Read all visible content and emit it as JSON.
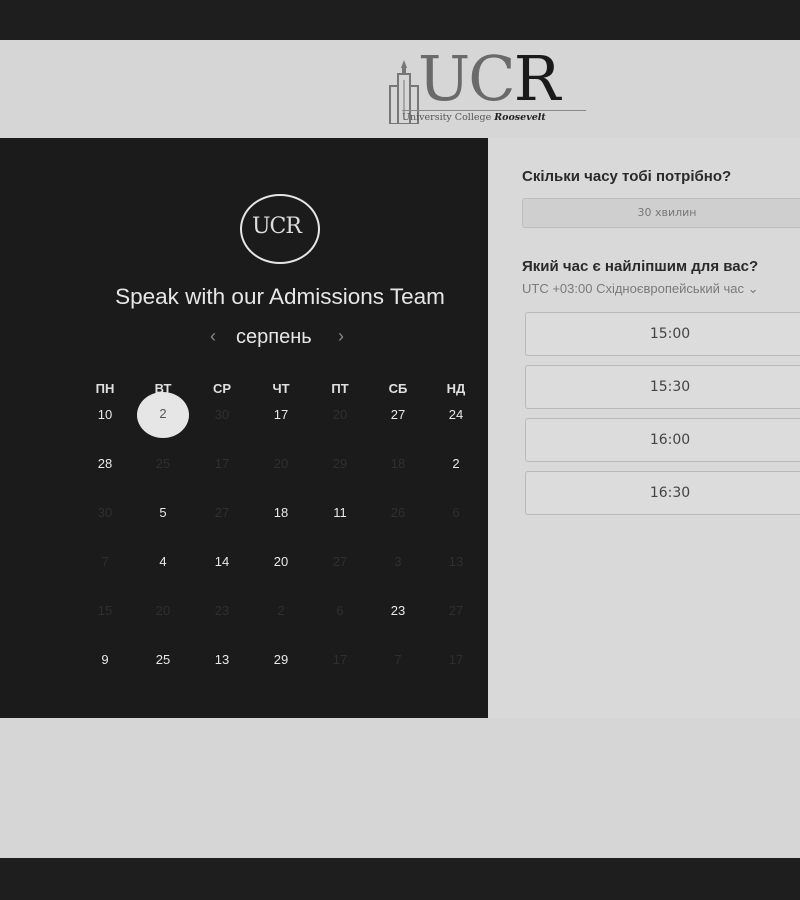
{
  "brand": {
    "logo_text_u": "U",
    "logo_text_c": "C",
    "logo_text_r": "R",
    "logo_sub": "University College",
    "logo_sub_italic": "Roosevelt",
    "circle_logo_text": "UCR"
  },
  "left": {
    "title": "Speak with our Admissions Team",
    "month": "серпень",
    "prev_icon": "‹",
    "next_icon": "›",
    "weekdays": [
      "ПН",
      "ВТ",
      "СР",
      "ЧТ",
      "ПТ",
      "СБ",
      "НД"
    ],
    "weeks": [
      [
        {
          "d": "10",
          "off": false
        },
        {
          "d": "2",
          "off": false,
          "sel": true
        },
        {
          "d": "30",
          "off": true
        },
        {
          "d": "17",
          "off": false
        },
        {
          "d": "20",
          "off": true
        },
        {
          "d": "27",
          "off": false
        },
        {
          "d": "24",
          "off": false
        }
      ],
      [
        {
          "d": "28",
          "off": false
        },
        {
          "d": "25",
          "off": true
        },
        {
          "d": "17",
          "off": true
        },
        {
          "d": "20",
          "off": true
        },
        {
          "d": "29",
          "off": true
        },
        {
          "d": "18",
          "off": true
        },
        {
          "d": "2",
          "off": false
        }
      ],
      [
        {
          "d": "30",
          "off": true
        },
        {
          "d": "5",
          "off": false
        },
        {
          "d": "27",
          "off": true
        },
        {
          "d": "18",
          "off": false
        },
        {
          "d": "11",
          "off": false
        },
        {
          "d": "26",
          "off": true
        },
        {
          "d": "6",
          "off": true
        }
      ],
      [
        {
          "d": "7",
          "off": true
        },
        {
          "d": "4",
          "off": false
        },
        {
          "d": "14",
          "off": false
        },
        {
          "d": "20",
          "off": false
        },
        {
          "d": "27",
          "off": true
        },
        {
          "d": "3",
          "off": true
        },
        {
          "d": "13",
          "off": true
        }
      ],
      [
        {
          "d": "15",
          "off": true
        },
        {
          "d": "20",
          "off": true
        },
        {
          "d": "23",
          "off": true
        },
        {
          "d": "2",
          "off": true
        },
        {
          "d": "6",
          "off": true
        },
        {
          "d": "23",
          "off": false
        },
        {
          "d": "27",
          "off": true
        }
      ],
      [
        {
          "d": "9",
          "off": false
        },
        {
          "d": "25",
          "off": false
        },
        {
          "d": "13",
          "off": false
        },
        {
          "d": "29",
          "off": false
        },
        {
          "d": "17",
          "off": true
        },
        {
          "d": "7",
          "off": true
        },
        {
          "d": "17",
          "off": true
        }
      ]
    ]
  },
  "right": {
    "q_duration": "Скільки часу тобі потрібно?",
    "duration_value": "30 хвилин",
    "q_time": "Який час є найліпшим для вас?",
    "timezone": "UTC +03:00 Східноєвропейський час",
    "timezone_chevron": "⌄",
    "slots": [
      "15:00",
      "15:30",
      "16:00",
      "16:30"
    ]
  }
}
